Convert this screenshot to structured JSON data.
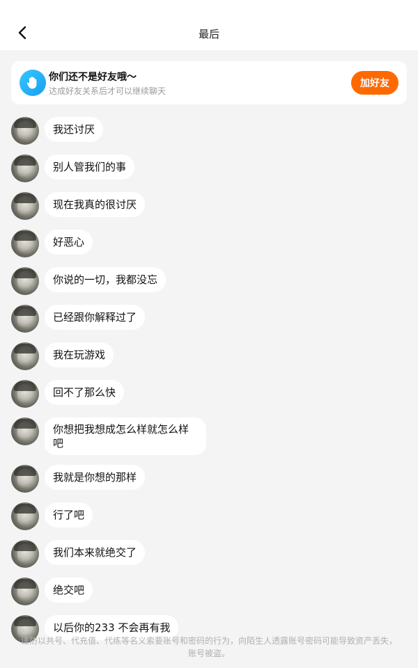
{
  "header": {
    "title": "最后",
    "back_icon": "chevron-left-icon"
  },
  "friend_card": {
    "icon": "hand-wave-icon",
    "icon_color": "#2bb5f8",
    "title": "你们还不是好友哦～",
    "subtitle": "达成好友关系后才可以继续聊天",
    "button_label": "加好友",
    "button_color": "#ff6a00"
  },
  "messages": [
    "我还讨厌",
    "别人管我们的事",
    "现在我真的很讨厌",
    "好恶心",
    "你说的一切，我都没忘",
    "已经跟你解释过了",
    "我在玩游戏",
    "回不了那么快",
    "你想把我想成怎么样就怎么样吧",
    "我就是你想的那样",
    "行了吧",
    "我们本来就绝交了",
    "绝交吧",
    "以后你的233 不会再有我"
  ],
  "footer": {
    "notice": "谨防以共号、代充值、代练等名义索要账号和密码的行为，向陌生人透露账号密码可能导致资产丢失，账号被盗。"
  }
}
